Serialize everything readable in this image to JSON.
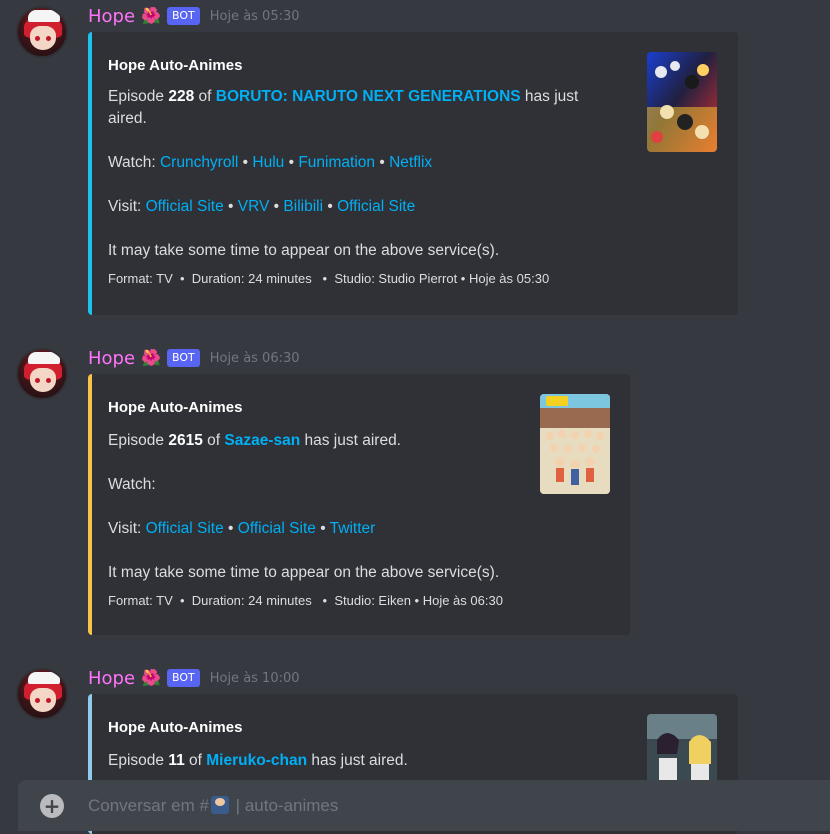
{
  "messages": [
    {
      "username": "Hope",
      "flower": "🌺",
      "bot_tag": "BOT",
      "timestamp": "Hoje às 05:30",
      "embed": {
        "color": "#1ec2ee",
        "title": "Hope Auto-Animes",
        "episode_prefix": "Episode ",
        "episode_number": "228",
        "episode_of": " of ",
        "anime": "BORUTO: NARUTO NEXT GENERATIONS",
        "aired_suffix": " has just",
        "aired_suffix_2": "aired.",
        "watch_label": "Watch: ",
        "watch_links": [
          "Crunchyroll",
          "Hulu",
          "Funimation",
          "Netflix"
        ],
        "visit_label": "Visit: ",
        "visit_links": [
          "Official Site",
          "VRV",
          "Bilibili",
          "Official Site"
        ],
        "note": "It may take some time to appear on the above service(s).",
        "footer": "Format: TV  •  Duration: 24 minutes   •  Studio: Studio Pierrot • Hoje às 05:30"
      }
    },
    {
      "username": "Hope",
      "flower": "🌺",
      "bot_tag": "BOT",
      "timestamp": "Hoje às 06:30",
      "embed": {
        "color": "#f7c448",
        "title": "Hope Auto-Animes",
        "episode_prefix": "Episode ",
        "episode_number": "2615",
        "episode_of": " of ",
        "anime": "Sazae-san",
        "aired_suffix": " has just aired.",
        "watch_label": "Watch:",
        "visit_label": "Visit: ",
        "visit_links": [
          "Official Site",
          "Official Site",
          "Twitter"
        ],
        "note": "It may take some time to appear on the above service(s).",
        "footer": "Format: TV  •  Duration: 24 minutes   •  Studio: Eiken • Hoje às 06:30"
      }
    },
    {
      "username": "Hope",
      "flower": "🌺",
      "bot_tag": "BOT",
      "timestamp": "Hoje às 10:00",
      "embed": {
        "color": "#8ecbec",
        "title": "Hope Auto-Animes",
        "episode_prefix": "Episode ",
        "episode_number": "11",
        "episode_of": " of ",
        "anime": "Mieruko-chan",
        "aired_suffix": " has just aired."
      }
    }
  ],
  "chat_input": {
    "placeholder_prefix": "Conversar em #",
    "channel_divider": "|",
    "channel_name": "auto-animes",
    "add_icon": "plus-circle-icon"
  }
}
